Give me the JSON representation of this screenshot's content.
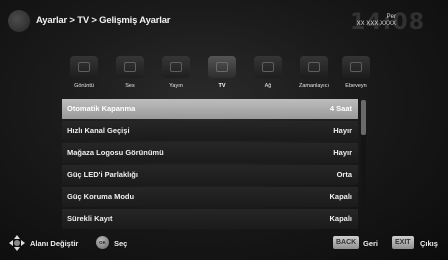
{
  "header": {
    "breadcrumb": "Ayarlar > TV > Gelişmiş Ayarlar",
    "day": "Per",
    "date": "XX XXX XXXX",
    "time": "14:08"
  },
  "tabs": [
    {
      "label": "Görüntü",
      "icon": "picture-icon",
      "active": false
    },
    {
      "label": "Ses",
      "icon": "sound-icon",
      "active": false
    },
    {
      "label": "Yayın",
      "icon": "broadcast-icon",
      "active": false
    },
    {
      "label": "TV",
      "icon": "tv-icon",
      "active": true
    },
    {
      "label": "Ağ",
      "icon": "network-icon",
      "active": false
    },
    {
      "label": "Zamanlayıcı",
      "icon": "timer-icon",
      "active": false
    },
    {
      "label": "Ebeveyn",
      "icon": "parental-icon",
      "active": false
    }
  ],
  "menu": [
    {
      "label": "Otomatik Kapanma",
      "value": "4 Saat",
      "selected": true
    },
    {
      "label": "Hızlı Kanal Geçişi",
      "value": "Hayır",
      "selected": false
    },
    {
      "label": "Mağaza Logosu Görünümü",
      "value": "Hayır",
      "selected": false
    },
    {
      "label": "Güç LED'i Parlaklığı",
      "value": "Orta",
      "selected": false
    },
    {
      "label": "Güç Koruma Modu",
      "value": "Kapalı",
      "selected": false
    },
    {
      "label": "Sürekli Kayıt",
      "value": "Kapalı",
      "selected": false
    }
  ],
  "scroll": {
    "position": 0.0,
    "visible_fraction": 0.3
  },
  "footer": {
    "change_area": "Alanı Değiştir",
    "ok_key": "OK",
    "select": "Seç",
    "back_key": "BACK",
    "back": "Geri",
    "exit_key": "EXIT",
    "exit": "Çıkış"
  },
  "colors": {
    "selected_row": "#b0b0b0",
    "row_bg": "#222222",
    "background": "#1a1a1a"
  }
}
